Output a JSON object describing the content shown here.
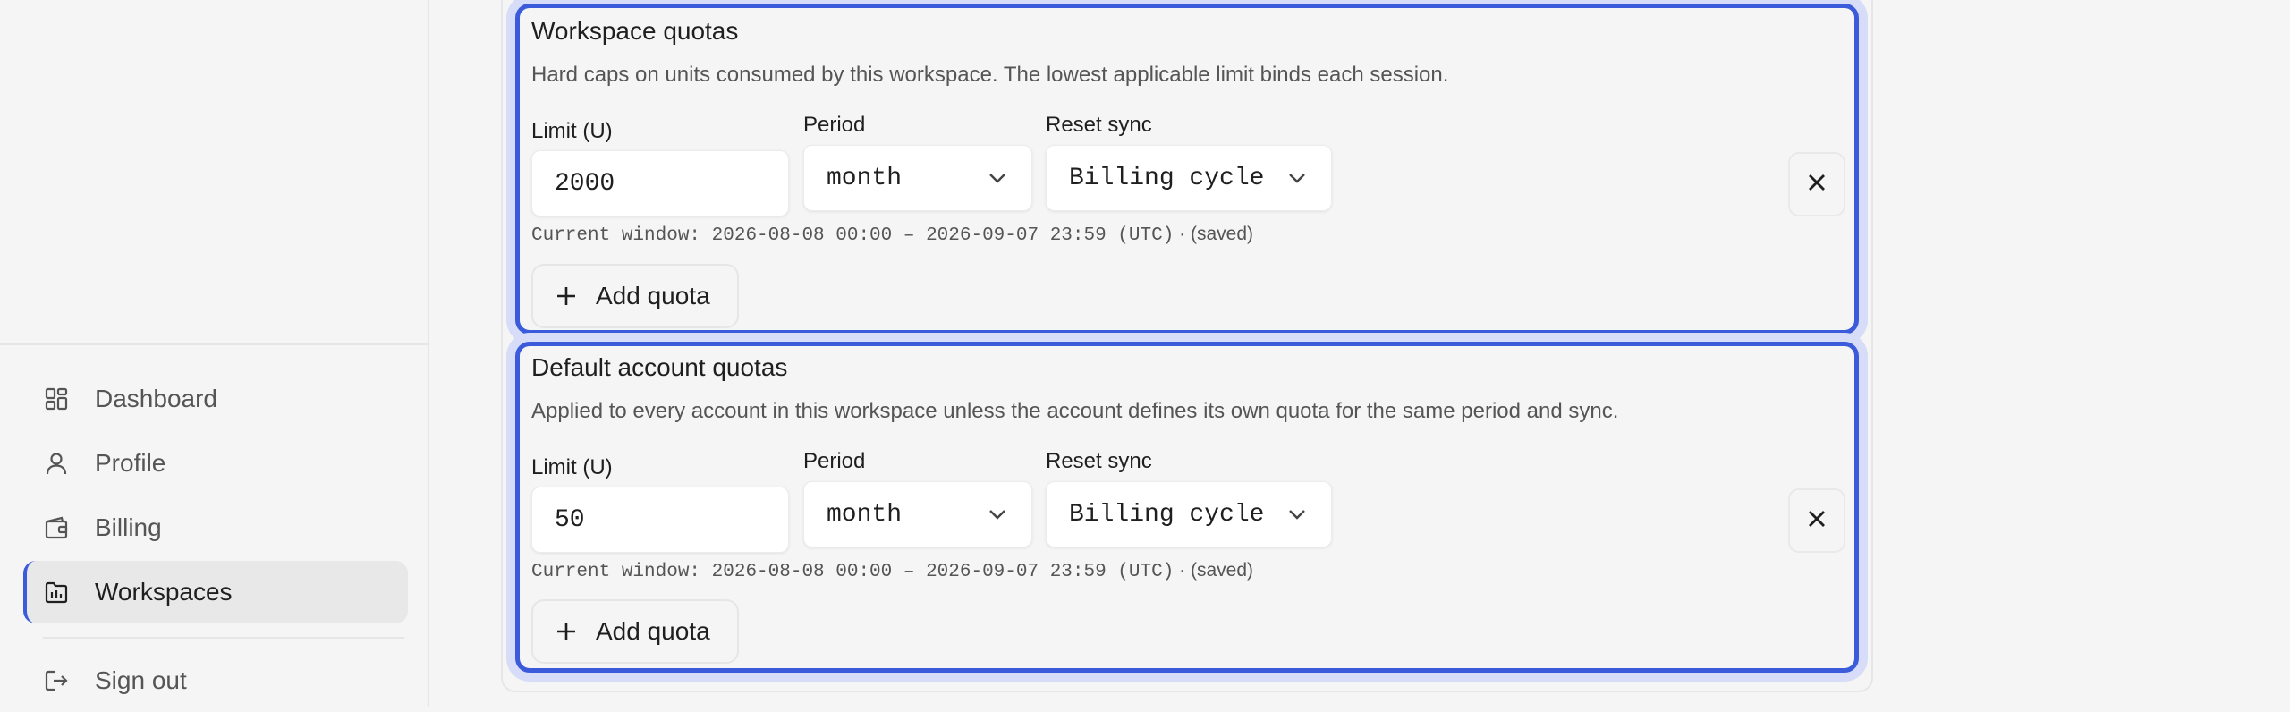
{
  "sidebar": {
    "items": [
      {
        "label": "Dashboard",
        "icon": "dashboard-icon"
      },
      {
        "label": "Profile",
        "icon": "user-icon"
      },
      {
        "label": "Billing",
        "icon": "wallet-icon"
      },
      {
        "label": "Workspaces",
        "icon": "workspace-icon",
        "active": true
      },
      {
        "label": "Sign out",
        "icon": "sign-out-icon"
      }
    ]
  },
  "sections": [
    {
      "title": "Workspace quotas",
      "description": "Hard caps on units consumed by this workspace. The lowest applicable limit binds each session.",
      "limit_label": "Limit (U)",
      "limit_value": "2000",
      "period_label": "Period",
      "period_value": "month",
      "reset_label": "Reset sync",
      "reset_value": "Billing cycle",
      "window_text": "Current window: 2026-08-08 00:00 – 2026-09-07 23:59 (UTC)",
      "saved_text": "· (saved)",
      "add_label": "Add quota"
    },
    {
      "title": "Default account quotas",
      "description": "Applied to every account in this workspace unless the account defines its own quota for the same period and sync.",
      "limit_label": "Limit (U)",
      "limit_value": "50",
      "period_label": "Period",
      "period_value": "month",
      "reset_label": "Reset sync",
      "reset_value": "Billing cycle",
      "window_text": "Current window: 2026-08-08 00:00 – 2026-09-07 23:59 (UTC)",
      "saved_text": "· (saved)",
      "add_label": "Add quota"
    }
  ],
  "colors": {
    "accent": "#3b5bdb",
    "focus_ring": "#d7ddf8",
    "background": "#f5f5f5"
  }
}
